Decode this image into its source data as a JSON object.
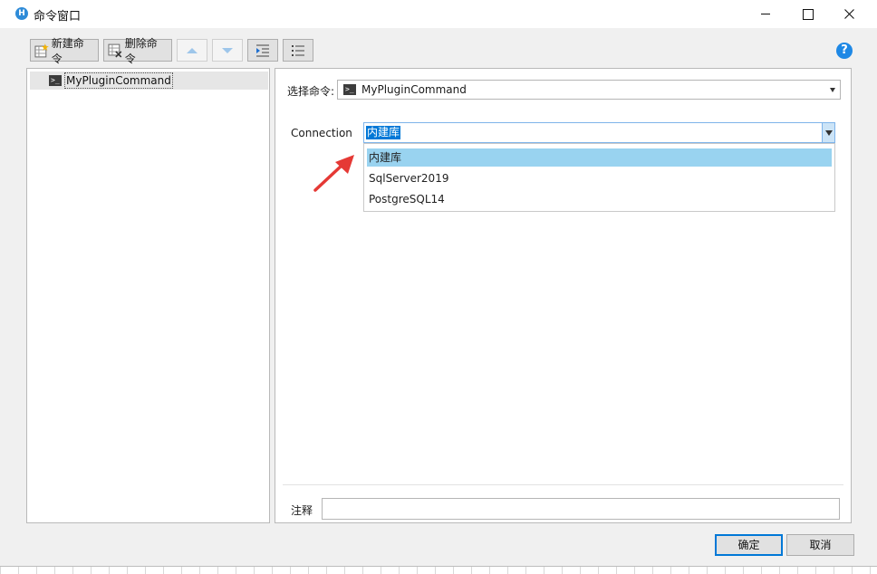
{
  "window": {
    "title": "命令窗口"
  },
  "toolbar": {
    "new_label": "新建命令",
    "delete_label": "删除命令"
  },
  "tree": {
    "items": [
      {
        "label": "MyPluginCommand"
      }
    ]
  },
  "editor": {
    "select_label": "选择命令:",
    "selected_command": "MyPluginCommand",
    "connection_label": "Connection",
    "connection_value": "内建库",
    "connection_options": [
      "内建库",
      "SqlServer2019",
      "PostgreSQL14"
    ],
    "note_label": "注释",
    "note_value": ""
  },
  "buttons": {
    "ok": "确定",
    "cancel": "取消"
  },
  "colors": {
    "accent": "#0078d7",
    "selection_highlight": "#99d3f0",
    "annotation_arrow": "#e53935",
    "help_icon": "#1e88e5"
  }
}
